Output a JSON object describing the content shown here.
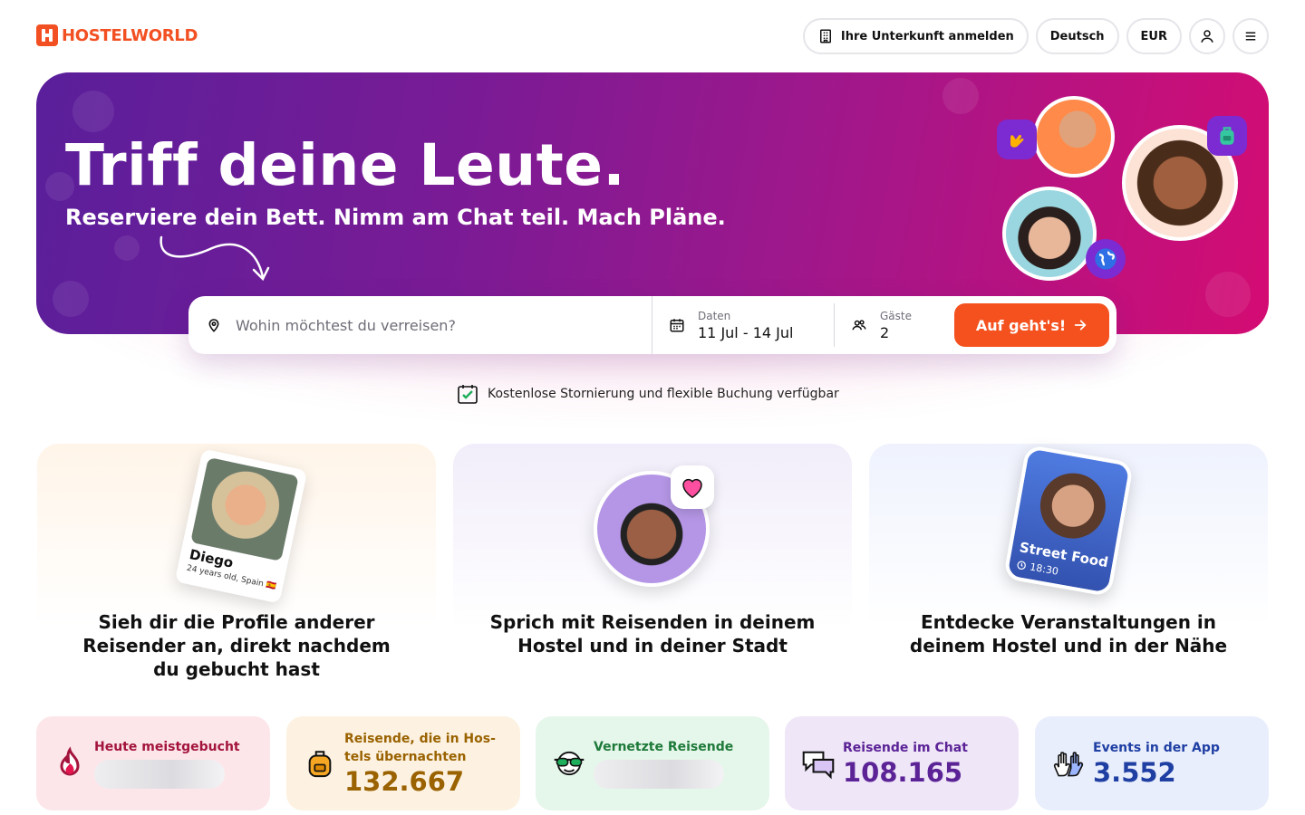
{
  "header": {
    "logo_text": "HOSTELWORLD",
    "register_label": "Ihre Unterkunft anmelden",
    "language": "Deutsch",
    "currency": "EUR"
  },
  "hero": {
    "title": "Triff deine Leute.",
    "subtitle": "Reserviere dein Bett. Nimm am Chat teil. Mach Pläne."
  },
  "search": {
    "destination_placeholder": "Wohin möchtest du verreisen?",
    "dates_label": "Daten",
    "dates_value": "11 Jul - 14 Jul",
    "guests_label": "Gäste",
    "guests_value": "2",
    "submit_label": "Auf geht's!"
  },
  "cancellation_note": "Kostenlose Stornierung und flexible Buchung verfügbar",
  "features": [
    {
      "title": "Sieh dir die Profile anderer Reisender an, direkt nachdem du gebucht hast",
      "card_name": "Diego",
      "card_meta": "24 years old, Spain 🇪🇸"
    },
    {
      "title": "Sprich mit Reisenden in deinem Hostel und in deiner Stadt"
    },
    {
      "title": "Entdecke Veranstaltungen in deinem Hostel und in der Nähe",
      "card_event": "Street Food",
      "card_time": "18:30"
    }
  ],
  "stats": [
    {
      "label": "Heute meistgebucht",
      "value": "",
      "color": "#a3143c",
      "icon": "fire-icon"
    },
    {
      "label": "Reisende, die in Hos-tels übernachten",
      "value": "132.667",
      "color": "#9a6200",
      "icon": "backpack-icon"
    },
    {
      "label": "Vernetzte Reisende",
      "value": "",
      "color": "#1e7a3a",
      "icon": "sunglasses-icon"
    },
    {
      "label": "Reisende im Chat",
      "value": "108.165",
      "color": "#5b2396",
      "icon": "chat-bubbles-icon"
    },
    {
      "label": "Events in der App",
      "value": "3.552",
      "color": "#1f3fa3",
      "icon": "waving-hands-icon"
    }
  ],
  "colors": {
    "brand": "#f25022",
    "cta": "#f4511e",
    "hero_start": "#5a1f9b",
    "hero_end": "#d40c73"
  }
}
